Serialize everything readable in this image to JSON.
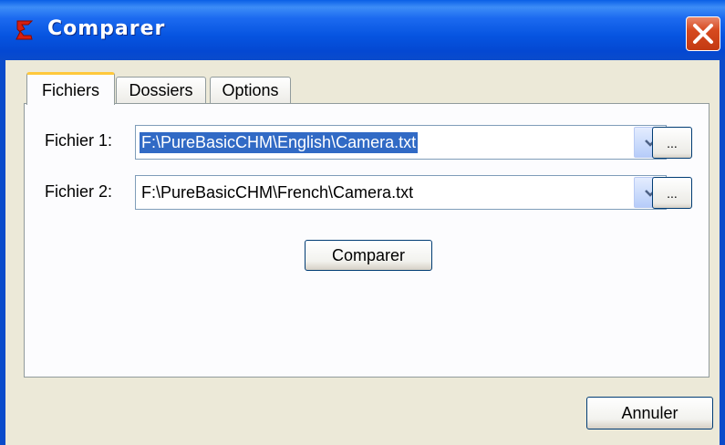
{
  "window": {
    "title": "Comparer",
    "icon": "app-logo-icon",
    "close_icon": "close-icon"
  },
  "tabs": [
    {
      "label": "Fichiers",
      "active": true
    },
    {
      "label": "Dossiers",
      "active": false
    },
    {
      "label": "Options",
      "active": false
    }
  ],
  "files": {
    "file1": {
      "label": "Fichier 1:",
      "value": "F:\\PureBasicCHM\\English\\Camera.txt",
      "browse_label": "..."
    },
    "file2": {
      "label": "Fichier 2:",
      "value": "F:\\PureBasicCHM\\French\\Camera.txt",
      "browse_label": "..."
    }
  },
  "actions": {
    "compare_label": "Comparer",
    "cancel_label": "Annuler"
  },
  "colors": {
    "titlebar": "#0A4BCB",
    "selection": "#316AC5",
    "active_tab_accent": "#FFC83C",
    "close_button": "#D6491E"
  }
}
